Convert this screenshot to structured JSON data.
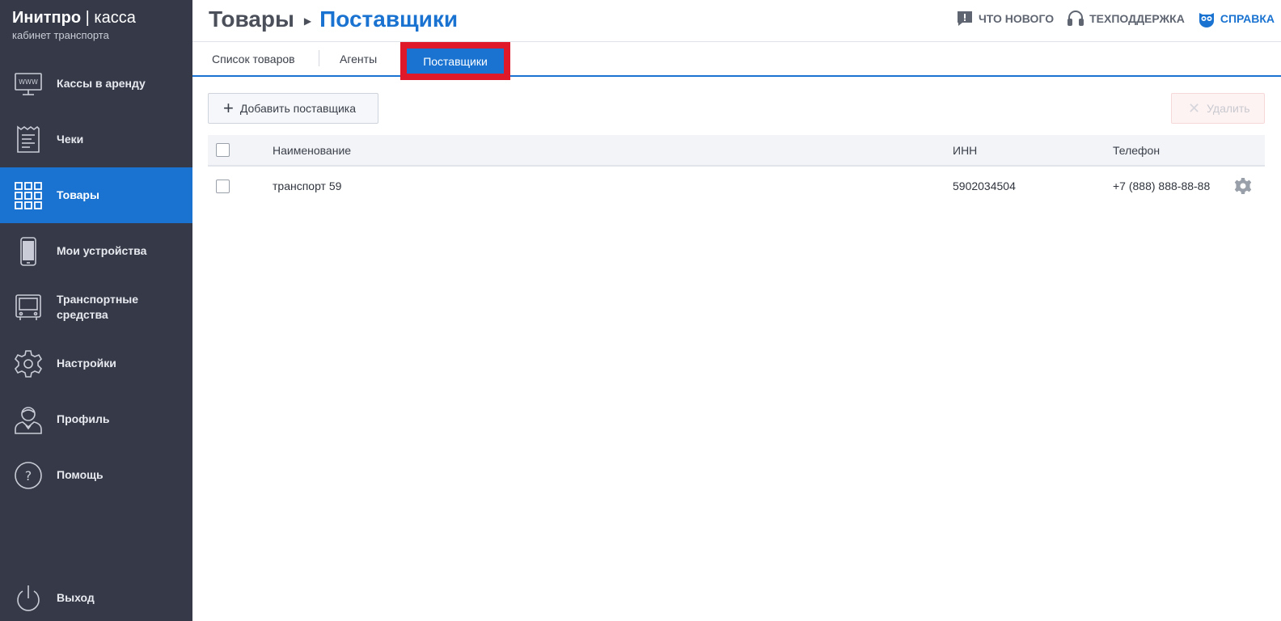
{
  "brand": {
    "name_bold": "Инитпро",
    "separator": "|",
    "name_light": "касса",
    "subtitle": "кабинет транспорта"
  },
  "sidebar": {
    "items": [
      {
        "label": "Кассы в аренду",
        "icon": "www-monitor-icon",
        "active": false
      },
      {
        "label": "Чеки",
        "icon": "receipt-icon",
        "active": false
      },
      {
        "label": "Товары",
        "icon": "grid-icon",
        "active": true
      },
      {
        "label": "Мои устройства",
        "icon": "phone-icon",
        "active": false
      },
      {
        "label": "Транспортные средства",
        "icon": "bus-icon",
        "active": false
      },
      {
        "label": "Настройки",
        "icon": "gear-icon",
        "active": false
      },
      {
        "label": "Профиль",
        "icon": "user-icon",
        "active": false
      },
      {
        "label": "Помощь",
        "icon": "help-icon",
        "active": false
      }
    ],
    "logout": {
      "label": "Выход",
      "icon": "power-icon"
    }
  },
  "header": {
    "breadcrumb_root": "Товары",
    "breadcrumb_current": "Поставщики",
    "links": {
      "whats_new": "ЧТО НОВОГО",
      "support": "ТЕХПОДДЕРЖКА",
      "help": "СПРАВКА"
    }
  },
  "tabs": [
    {
      "label": "Список товаров",
      "active": false
    },
    {
      "label": "Агенты",
      "active": false
    },
    {
      "label": "Поставщики",
      "active": true
    }
  ],
  "toolbar": {
    "add_label": "Добавить поставщика",
    "delete_label": "Удалить"
  },
  "table": {
    "columns": [
      "Наименование",
      "ИНН",
      "Телефон"
    ],
    "rows": [
      {
        "name": "транспорт 59",
        "inn": "5902034504",
        "phone": "+7 (888) 888-88-88"
      }
    ]
  },
  "colors": {
    "sidebar_bg": "#363a48",
    "accent": "#1a73d1",
    "highlight_frame": "#e0192a"
  }
}
